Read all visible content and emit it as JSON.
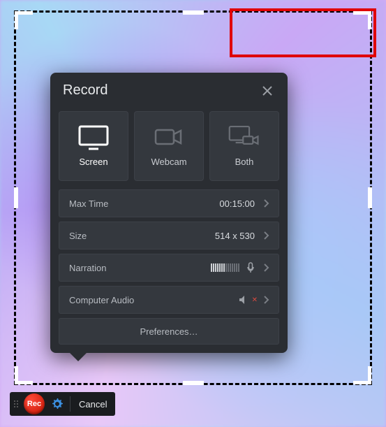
{
  "panel": {
    "title": "Record",
    "modes": {
      "screen": "Screen",
      "webcam": "Webcam",
      "both": "Both"
    },
    "rows": {
      "max_time": {
        "label": "Max Time",
        "value": "00:15:00"
      },
      "size": {
        "label": "Size",
        "value": "514 x 530"
      },
      "narration": {
        "label": "Narration"
      },
      "computer_audio": {
        "label": "Computer Audio"
      }
    },
    "preferences": "Preferences…"
  },
  "toolbar": {
    "rec": "Rec",
    "cancel": "Cancel"
  }
}
